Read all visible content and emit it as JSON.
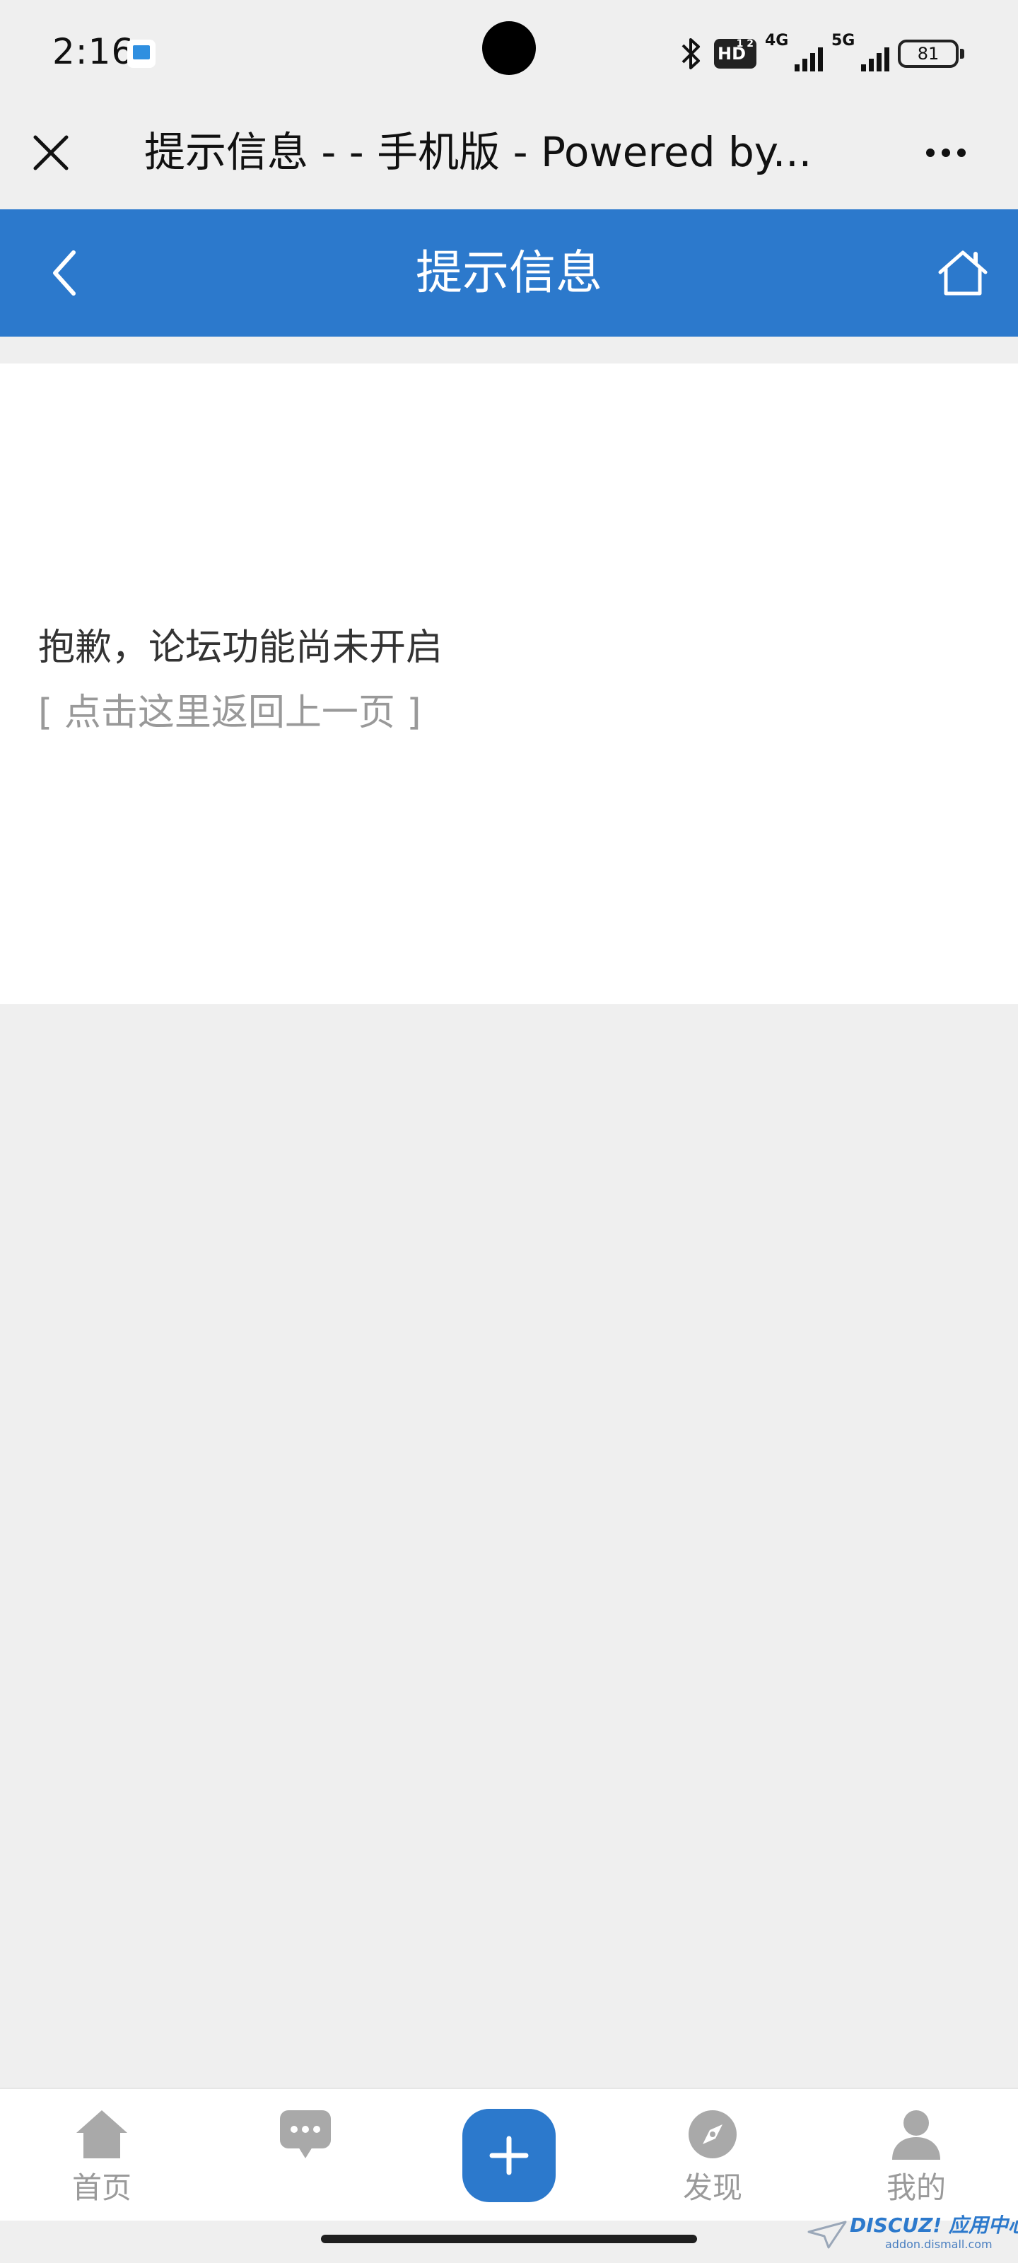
{
  "status_bar": {
    "time": "2:16",
    "hd_label": "HD",
    "hd_sub": "1 2",
    "network_1": "4G",
    "network_2": "5G",
    "battery": "81"
  },
  "browser": {
    "title": "提示信息 - - 手机版 - Powered by..."
  },
  "header": {
    "title": "提示信息"
  },
  "content": {
    "message": "抱歉，论坛功能尚未开启",
    "back_link": "[ 点击这里返回上一页 ]"
  },
  "tabbar": {
    "home": "首页",
    "messages": "",
    "discover": "发现",
    "mine": "我的"
  },
  "watermark": {
    "main": "DISCUZ! 应用中心",
    "sub": "addon.dismall.com"
  },
  "colors": {
    "primary": "#2c79cc",
    "background": "#efefef",
    "tab_icon": "#a9a9a9"
  }
}
